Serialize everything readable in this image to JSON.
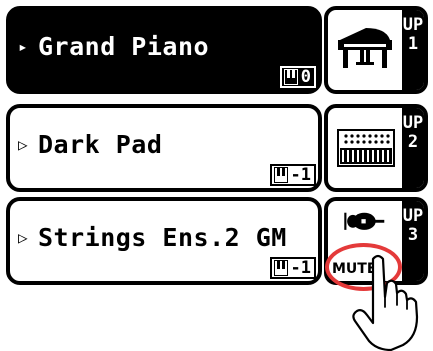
{
  "sounds": [
    {
      "name": "Grand Piano",
      "octave": "0",
      "selected": true
    },
    {
      "name": "Dark Pad",
      "octave": "-1",
      "selected": false
    },
    {
      "name": "Strings Ens.2 GM",
      "octave": "-1",
      "selected": false
    }
  ],
  "parts": [
    {
      "label": "UP1",
      "icon": "piano-icon"
    },
    {
      "label": "UP2",
      "icon": "keyboard-icon"
    },
    {
      "label": "UP3",
      "icon": "strings-icon",
      "status": "MUTE"
    }
  ],
  "arrows": {
    "selected": "▸",
    "normal": "▷"
  },
  "colors": {
    "highlight": "#e43a3a"
  }
}
